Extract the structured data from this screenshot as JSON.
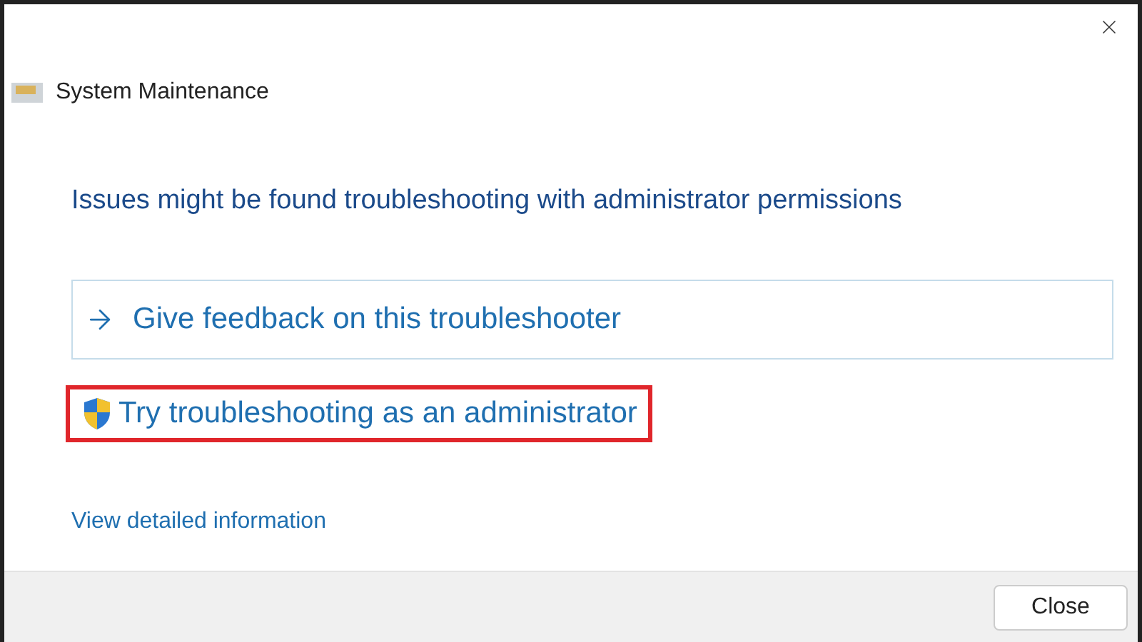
{
  "window": {
    "title": "System Maintenance"
  },
  "heading": "Issues might be found troubleshooting with administrator permissions",
  "options": [
    {
      "kind": "command",
      "label": "Give feedback on this troubleshooter",
      "highlighted": false
    },
    {
      "kind": "admin",
      "label": "Try troubleshooting as an administrator",
      "highlighted": true
    }
  ],
  "details_link": "View detailed information",
  "buttons": [
    "Close"
  ]
}
